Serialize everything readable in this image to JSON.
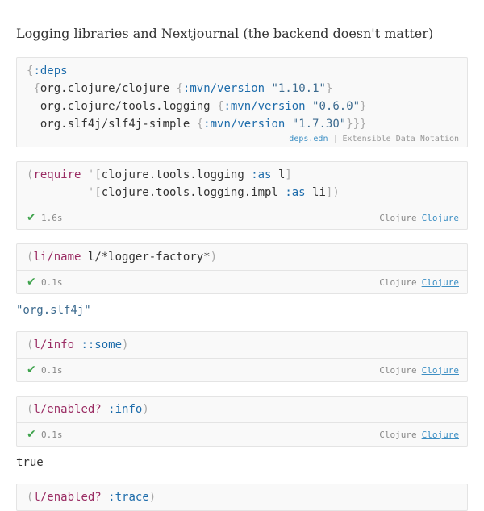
{
  "heading": "Logging libraries and Nextjournal (the backend doesn't matter)",
  "deps": {
    "open_map": "{",
    "root_key": ":deps",
    "line1_open": "{",
    "lib1": "org.clojure/clojure",
    "lib1_open": "{",
    "mvn_key": ":mvn/version",
    "lib1_version": "\"1.10.1\"",
    "lib1_close": "}",
    "lib2": "org.clojure/tools.logging",
    "lib2_open": "{",
    "lib2_version": "\"0.6.0\"",
    "lib2_close": "}",
    "lib3": "org.slf4j/slf4j-simple",
    "lib3_open": "{",
    "lib3_version": "\"1.7.30\"",
    "lib3_close": "}}}",
    "filename": "deps.edn",
    "separator": "|",
    "format": "Extensible Data Notation"
  },
  "cells": [
    {
      "time": "1.6s",
      "lang": "Clojure",
      "lang_link": "Clojure"
    },
    {
      "time": "0.1s",
      "lang": "Clojure",
      "lang_link": "Clojure",
      "result": "\"org.slf4j\""
    },
    {
      "time": "0.1s",
      "lang": "Clojure",
      "lang_link": "Clojure"
    },
    {
      "time": "0.1s",
      "lang": "Clojure",
      "lang_link": "Clojure",
      "result": "true"
    }
  ],
  "code": {
    "c1_l1_paren": "(",
    "c1_require": "require",
    "c1_l1_quote": "'[",
    "c1_l1_ns": "clojure.tools.logging",
    "c1_as": ":as",
    "c1_l1_alias": "l",
    "c1_l1_close": "]",
    "c1_l2_quote": "'[",
    "c1_l2_ns": "clojure.tools.logging.impl",
    "c1_l2_alias": "li",
    "c1_l2_close": "])",
    "c2_open": "(",
    "c2_fn": "li/name",
    "c2_arg": "l/*logger-factory*",
    "c2_close": ")",
    "c3_open": "(",
    "c3_fn": "l/info",
    "c3_arg": "::some",
    "c3_close": ")",
    "c4_open": "(",
    "c4_fn": "l/enabled?",
    "c4_arg": ":info",
    "c4_close": ")",
    "c5_open": "(",
    "c5_fn": "l/enabled?",
    "c5_arg": ":trace",
    "c5_close": ")"
  },
  "icons": {
    "success": "check-icon"
  },
  "colors": {
    "keyword": "#9a2c63",
    "key": "#1d6cab",
    "string": "#3d6b8f",
    "success": "#3fa34d",
    "link": "#3d8fc4"
  }
}
